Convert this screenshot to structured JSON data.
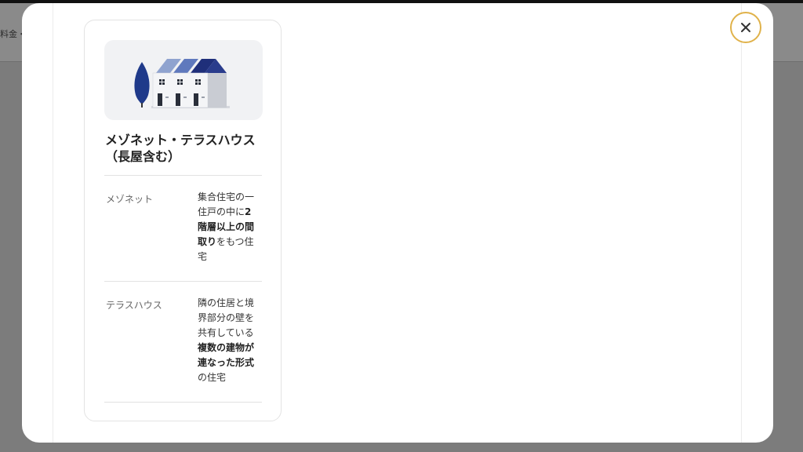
{
  "background": {
    "snippet": "料金・"
  },
  "modal": {
    "close_icon": "close-icon",
    "card": {
      "illustration": "terrace-house-illustration",
      "title_line1": "メゾネット・テラスハウス",
      "title_line2": "（長屋含む）",
      "rows": [
        {
          "term": "メゾネット",
          "desc_parts": [
            {
              "text": "集合住宅の一住戸の中に",
              "bold": false
            },
            {
              "text": "2階層以上の間取り",
              "bold": true
            },
            {
              "text": "をもつ住宅",
              "bold": false
            }
          ],
          "desc_lines": [
            [
              {
                "t": "集合住宅の一",
                "b": false
              }
            ],
            [
              {
                "t": "住戸の中に",
                "b": false
              },
              {
                "t": "2",
                "b": true
              }
            ],
            [
              {
                "t": "階層以上の間",
                "b": true
              }
            ],
            [
              {
                "t": "取り",
                "b": true
              },
              {
                "t": "をもつ住",
                "b": false
              }
            ],
            [
              {
                "t": "宅",
                "b": false
              }
            ]
          ]
        },
        {
          "term": "テラスハウス",
          "desc_parts": [
            {
              "text": "隣の住居と境界部分の壁を共有している",
              "bold": false
            },
            {
              "text": "複数の建物が連なった形式",
              "bold": true
            },
            {
              "text": "の住宅",
              "bold": false
            }
          ],
          "desc_lines": [
            [
              {
                "t": "隣の住居と境",
                "b": false
              }
            ],
            [
              {
                "t": "界部分の壁を",
                "b": false
              }
            ],
            [
              {
                "t": "共有している",
                "b": false
              }
            ],
            [
              {
                "t": "複数の建物が",
                "b": true
              }
            ],
            [
              {
                "t": "連なった形式",
                "b": true
              }
            ],
            [
              {
                "t": "の住宅",
                "b": false
              }
            ]
          ]
        }
      ]
    }
  },
  "colors": {
    "overlay": "#7c7c7c",
    "close_ring": "#e0b24a",
    "house_roof": "#1f2f7a",
    "tree": "#1f3a8a"
  }
}
